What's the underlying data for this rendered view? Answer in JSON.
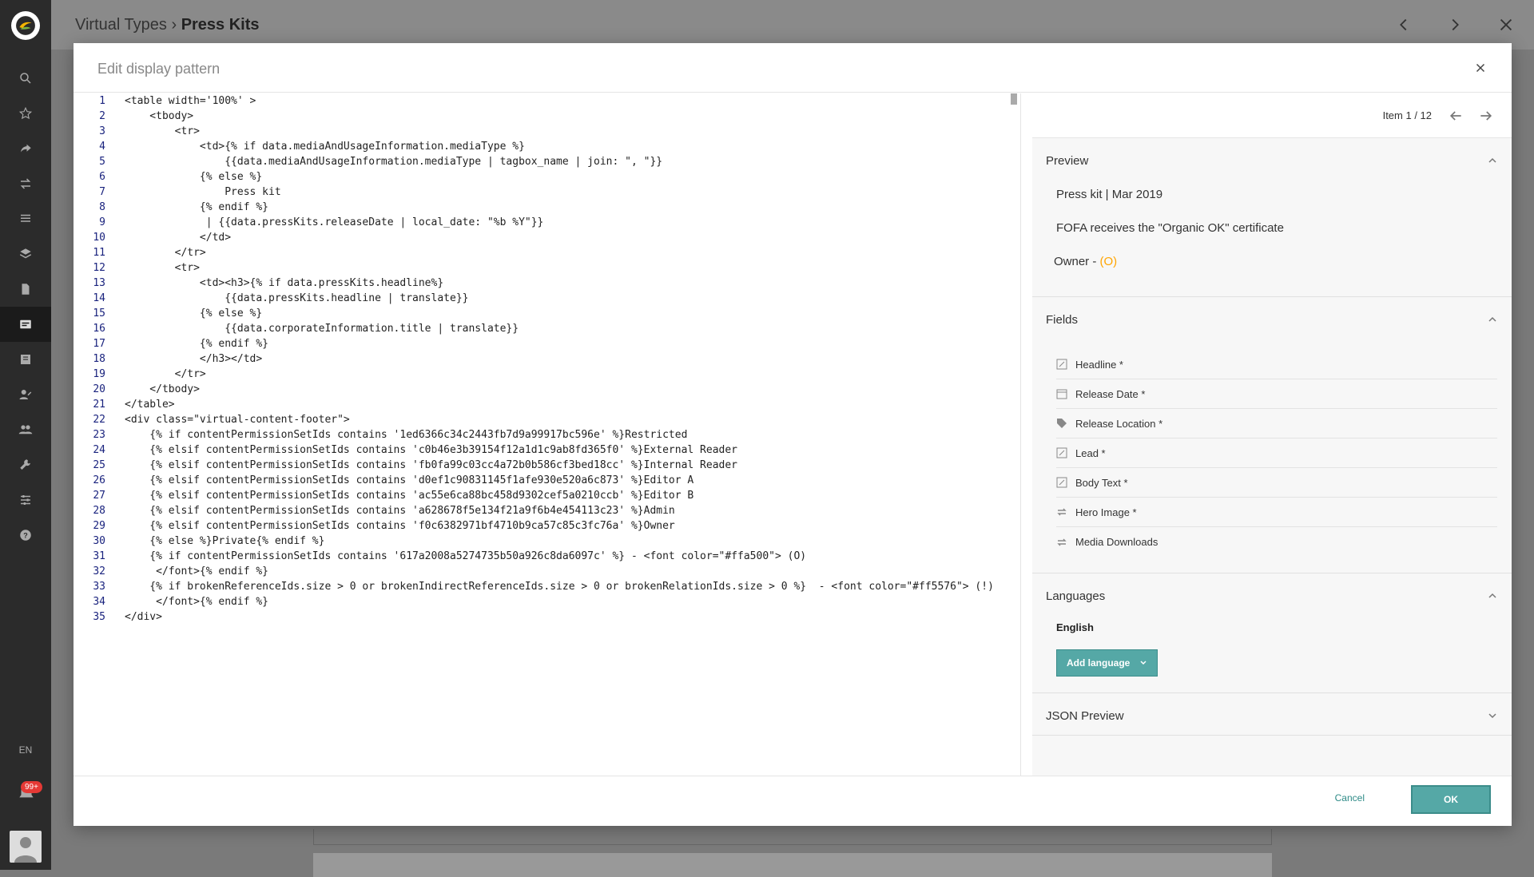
{
  "breadcrumb": {
    "parent": "Virtual Types",
    "separator": "›",
    "current": "Press Kits"
  },
  "sidebar": {
    "language": "EN",
    "notifications": "99+"
  },
  "modal": {
    "title": "Edit display pattern",
    "code_lines": [
      "<table width='100%' >",
      "    <tbody>",
      "        <tr>",
      "            <td>{% if data.mediaAndUsageInformation.mediaType %}",
      "                {{data.mediaAndUsageInformation.mediaType | tagbox_name | join: \", \"}}",
      "            {% else %}",
      "                Press kit",
      "            {% endif %}",
      "             | {{data.pressKits.releaseDate | local_date: \"%b %Y\"}}",
      "            </td>",
      "        </tr>",
      "        <tr>",
      "            <td><h3>{% if data.pressKits.headline%}",
      "                {{data.pressKits.headline | translate}}",
      "            {% else %}",
      "                {{data.corporateInformation.title | translate}}",
      "            {% endif %}",
      "            </h3></td>",
      "        </tr>",
      "    </tbody>",
      "</table>",
      "<div class=\"virtual-content-footer\">",
      "    {% if contentPermissionSetIds contains '1ed6366c34c2443fb7d9a99917bc596e' %}Restricted",
      "    {% elsif contentPermissionSetIds contains 'c0b46e3b39154f12a1d1c9ab8fd365f0' %}External Reader",
      "    {% elsif contentPermissionSetIds contains 'fb0fa99c03cc4a72b0b586cf3bed18cc' %}Internal Reader",
      "    {% elsif contentPermissionSetIds contains 'd0ef1c90831145f1afe930e520a6c873' %}Editor A",
      "    {% elsif contentPermissionSetIds contains 'ac55e6ca88bc458d9302cef5a0210ccb' %}Editor B",
      "    {% elsif contentPermissionSetIds contains 'a628678f5e134f21a9f6b4e454113c23' %}Admin",
      "    {% elsif contentPermissionSetIds contains 'f0c6382971bf4710b9ca57c85c3fc76a' %}Owner",
      "    {% else %}Private{% endif %}",
      "    {% if contentPermissionSetIds contains '617a2008a5274735b50a926c8da6097c' %} - <font color=\"#ffa500\"> (O)",
      "     </font>{% endif %}",
      "    {% if brokenReferenceIds.size > 0 or brokenIndirectReferenceIds.size > 0 or brokenRelationIds.size > 0 %}  - <font color=\"#ff5576\"> (!)",
      "     </font>{% endif %}",
      "</div>"
    ],
    "pager": {
      "text": "Item 1 / 12"
    },
    "preview": {
      "heading": "Preview",
      "line1": "Press kit | Mar 2019",
      "line2": "FOFA receives the \"Organic OK\" certificate",
      "owner_label": "Owner - ",
      "owner_value": "(O)"
    },
    "fields": {
      "heading": "Fields",
      "items": [
        {
          "label": "Headline *",
          "icon": "edit-icon"
        },
        {
          "label": "Release Date *",
          "icon": "calendar-icon"
        },
        {
          "label": "Release Location *",
          "icon": "tag-icon"
        },
        {
          "label": "Lead *",
          "icon": "edit-icon"
        },
        {
          "label": "Body Text *",
          "icon": "edit-icon"
        },
        {
          "label": "Hero Image *",
          "icon": "relation-icon"
        },
        {
          "label": "Media Downloads",
          "icon": "relation-icon"
        }
      ]
    },
    "languages": {
      "heading": "Languages",
      "current": "English",
      "add_label": "Add language"
    },
    "json_preview": {
      "heading": "JSON Preview"
    },
    "footer": {
      "cancel": "Cancel",
      "ok": "OK"
    }
  },
  "colors": {
    "accent": "#55a8a6",
    "owner": "#ffa500",
    "broken": "#ff5576"
  }
}
